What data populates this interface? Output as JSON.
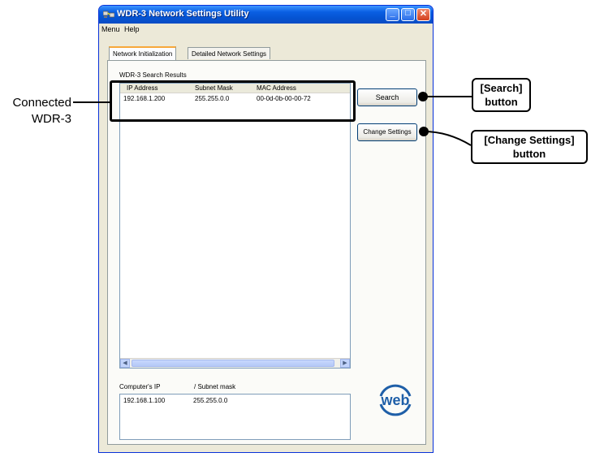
{
  "window": {
    "title": "WDR-3 Network Settings Utility",
    "controls": [
      "minimize",
      "maximize",
      "close"
    ]
  },
  "menu": [
    "Menu",
    "Help"
  ],
  "tabs": [
    {
      "label": "Network Initialization",
      "active": true
    },
    {
      "label": "Detailed Network Settings",
      "active": false
    }
  ],
  "search_results": {
    "label": "WDR-3 Search Results",
    "columns": [
      "IP Address",
      "Subnet Mask",
      "MAC Address"
    ],
    "rows": [
      [
        "192.168.1.200",
        "255.255.0.0",
        "00-0d-0b-00-00-72"
      ]
    ]
  },
  "buttons": {
    "search": "Search",
    "change_settings": "Change Settings"
  },
  "computer_info": {
    "col_ip": "Computer's IP",
    "col_mask": "/ Subnet mask",
    "ip": "192.168.1.100",
    "mask": "255.255.0.0"
  },
  "logo_text": "web",
  "annotations": {
    "connected_line1": "Connected",
    "connected_line2": "WDR-3",
    "search_line1": "[Search]",
    "search_line2": "button",
    "change_line1": "[Change Settings]",
    "change_line2": "button"
  },
  "colors": {
    "titlebar": "#0a5fe3",
    "window_bg": "#ece9d8",
    "logo": "#1f5fa8",
    "tab_accent": "#f7a83a"
  }
}
